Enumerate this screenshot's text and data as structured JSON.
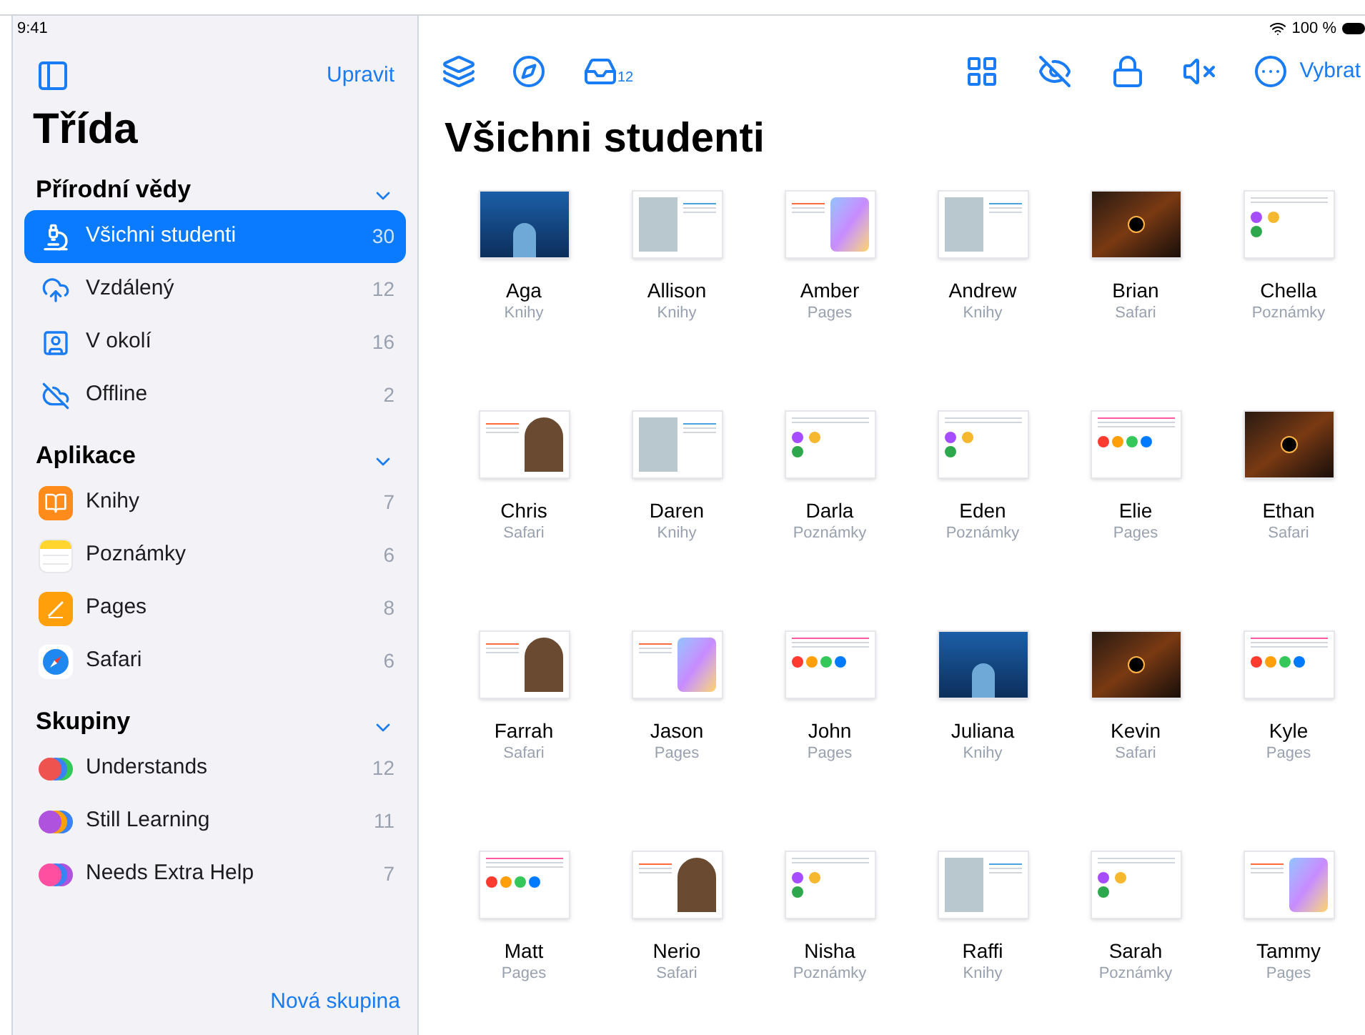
{
  "status_bar": {
    "time": "9:41",
    "battery": "100 %"
  },
  "sidebar": {
    "edit": "Upravit",
    "title": "Třída",
    "sections": [
      {
        "title": "Přírodní vědy",
        "expanded": true,
        "items": [
          {
            "kind": "microscope",
            "label": "Všichni studenti",
            "count": "30",
            "selected": true
          },
          {
            "kind": "cloud",
            "label": "Vzdálený",
            "count": "12",
            "selected": false
          },
          {
            "kind": "person",
            "label": "V okolí",
            "count": "16",
            "selected": false
          },
          {
            "kind": "offline",
            "label": "Offline",
            "count": "2",
            "selected": false
          }
        ]
      },
      {
        "title": "Aplikace",
        "expanded": true,
        "items": [
          {
            "kind": "books",
            "label": "Knihy",
            "count": "7",
            "selected": false
          },
          {
            "kind": "notes",
            "label": "Poznámky",
            "count": "6",
            "selected": false
          },
          {
            "kind": "pages",
            "label": "Pages",
            "count": "8",
            "selected": false
          },
          {
            "kind": "safari",
            "label": "Safari",
            "count": "6",
            "selected": false
          }
        ]
      },
      {
        "title": "Skupiny",
        "expanded": true,
        "items": [
          {
            "kind": "group",
            "label": "Understands",
            "count": "12",
            "selected": false,
            "dots": [
              {
                "color": "#ef5350"
              },
              {
                "color": "#3b82f6"
              },
              {
                "color": "#34c759"
              }
            ]
          },
          {
            "kind": "group",
            "label": "Still Learning",
            "count": "11",
            "selected": false,
            "dots": [
              {
                "color": "#af52de"
              },
              {
                "color": "#ff9f0a"
              },
              {
                "color": "#3b82f6"
              }
            ]
          },
          {
            "kind": "group",
            "label": "Needs Extra Help",
            "count": "7",
            "selected": false,
            "dots": [
              {
                "color": "#ff4fa0"
              },
              {
                "color": "#3b82f6"
              },
              {
                "color": "#af52de"
              }
            ]
          }
        ]
      }
    ],
    "new_group": "Nová skupina"
  },
  "toolbar": {
    "inbox_count": "12",
    "select": "Vybrat"
  },
  "main": {
    "title": "Všichni studenti",
    "students": [
      {
        "name": "Aga",
        "app": "Knihy",
        "kind": "dark"
      },
      {
        "name": "Allison",
        "app": "Knihy",
        "kind": "book"
      },
      {
        "name": "Amber",
        "app": "Pages",
        "kind": "map"
      },
      {
        "name": "Andrew",
        "app": "Knihy",
        "kind": "book"
      },
      {
        "name": "Brian",
        "app": "Safari",
        "kind": "space"
      },
      {
        "name": "Chella",
        "app": "Poznámky",
        "kind": "notes"
      },
      {
        "name": "Chris",
        "app": "Safari",
        "kind": "mammoth"
      },
      {
        "name": "Daren",
        "app": "Knihy",
        "kind": "book"
      },
      {
        "name": "Darla",
        "app": "Poznámky",
        "kind": "notes"
      },
      {
        "name": "Eden",
        "app": "Poznámky",
        "kind": "notes"
      },
      {
        "name": "Elie",
        "app": "Pages",
        "kind": "doc"
      },
      {
        "name": "Ethan",
        "app": "Safari",
        "kind": "space"
      },
      {
        "name": "Farrah",
        "app": "Safari",
        "kind": "mammoth"
      },
      {
        "name": "Jason",
        "app": "Pages",
        "kind": "map"
      },
      {
        "name": "John",
        "app": "Pages",
        "kind": "doc"
      },
      {
        "name": "Juliana",
        "app": "Knihy",
        "kind": "dark"
      },
      {
        "name": "Kevin",
        "app": "Safari",
        "kind": "space"
      },
      {
        "name": "Kyle",
        "app": "Pages",
        "kind": "doc"
      },
      {
        "name": "Matt",
        "app": "Pages",
        "kind": "doc"
      },
      {
        "name": "Nerio",
        "app": "Safari",
        "kind": "mammoth"
      },
      {
        "name": "Nisha",
        "app": "Poznámky",
        "kind": "notes"
      },
      {
        "name": "Raffi",
        "app": "Knihy",
        "kind": "book"
      },
      {
        "name": "Sarah",
        "app": "Poznámky",
        "kind": "notes"
      },
      {
        "name": "Tammy",
        "app": "Pages",
        "kind": "map"
      }
    ]
  }
}
